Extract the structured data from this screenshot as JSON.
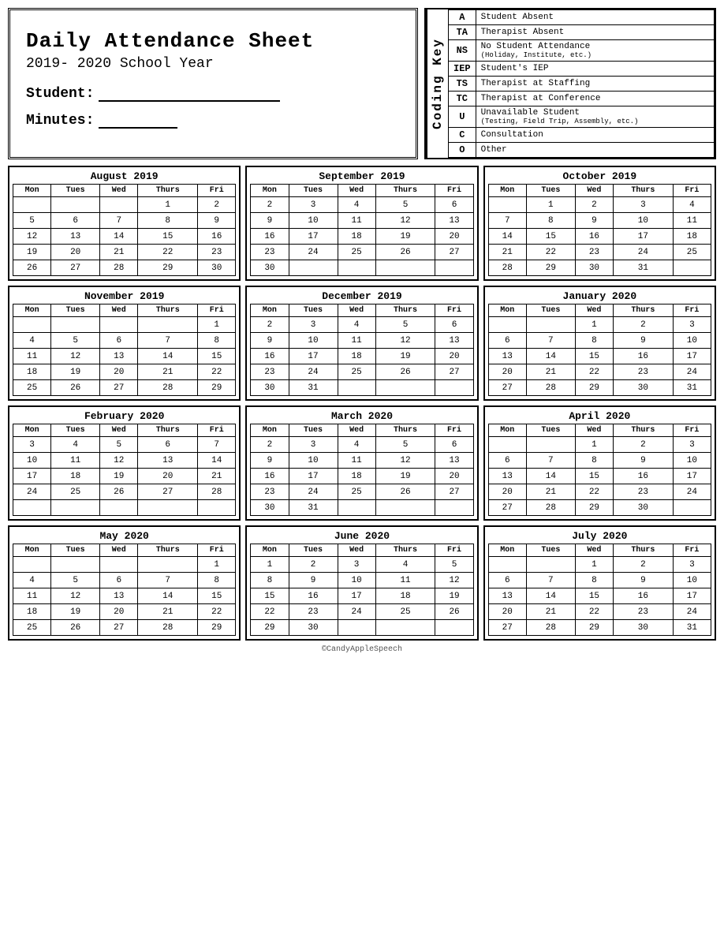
{
  "header": {
    "title": "Daily Attendance Sheet",
    "year": "2019- 2020 School Year",
    "student_label": "Student:",
    "minutes_label": "Minutes:",
    "coding_key_label": "Coding Key"
  },
  "coding_key": [
    {
      "code": "A",
      "description": "Student Absent",
      "sub": ""
    },
    {
      "code": "TA",
      "description": "Therapist Absent",
      "sub": ""
    },
    {
      "code": "NS",
      "description": "No Student Attendance",
      "sub": "(Holiday, Institute, etc.)"
    },
    {
      "code": "IEP",
      "description": "Student's IEP",
      "sub": ""
    },
    {
      "code": "TS",
      "description": "Therapist at Staffing",
      "sub": ""
    },
    {
      "code": "TC",
      "description": "Therapist at Conference",
      "sub": ""
    },
    {
      "code": "U",
      "description": "Unavailable Student",
      "sub": "(Testing, Field Trip, Assembly, etc.)"
    },
    {
      "code": "C",
      "description": "Consultation",
      "sub": ""
    },
    {
      "code": "O",
      "description": "Other",
      "sub": ""
    }
  ],
  "calendars": [
    {
      "title": "August 2019",
      "days": [
        [
          "",
          "",
          "",
          "1",
          "2"
        ],
        [
          "5",
          "6",
          "7",
          "8",
          "9"
        ],
        [
          "12",
          "13",
          "14",
          "15",
          "16"
        ],
        [
          "19",
          "20",
          "21",
          "22",
          "23"
        ],
        [
          "26",
          "27",
          "28",
          "29",
          "30"
        ]
      ]
    },
    {
      "title": "September 2019",
      "days": [
        [
          "2",
          "3",
          "4",
          "5",
          "6"
        ],
        [
          "9",
          "10",
          "11",
          "12",
          "13"
        ],
        [
          "16",
          "17",
          "18",
          "19",
          "20"
        ],
        [
          "23",
          "24",
          "25",
          "26",
          "27"
        ],
        [
          "30",
          "",
          "",
          "",
          ""
        ]
      ]
    },
    {
      "title": "October 2019",
      "days": [
        [
          "",
          "1",
          "2",
          "3",
          "4"
        ],
        [
          "7",
          "8",
          "9",
          "10",
          "11"
        ],
        [
          "14",
          "15",
          "16",
          "17",
          "18"
        ],
        [
          "21",
          "22",
          "23",
          "24",
          "25"
        ],
        [
          "28",
          "29",
          "30",
          "31",
          ""
        ]
      ]
    },
    {
      "title": "November 2019",
      "days": [
        [
          "",
          "",
          "",
          "",
          "1"
        ],
        [
          "4",
          "5",
          "6",
          "7",
          "8"
        ],
        [
          "11",
          "12",
          "13",
          "14",
          "15"
        ],
        [
          "18",
          "19",
          "20",
          "21",
          "22"
        ],
        [
          "25",
          "26",
          "27",
          "28",
          "29"
        ]
      ]
    },
    {
      "title": "December 2019",
      "days": [
        [
          "2",
          "3",
          "4",
          "5",
          "6"
        ],
        [
          "9",
          "10",
          "11",
          "12",
          "13"
        ],
        [
          "16",
          "17",
          "18",
          "19",
          "20"
        ],
        [
          "23",
          "24",
          "25",
          "26",
          "27"
        ],
        [
          "30",
          "31",
          "",
          "",
          ""
        ]
      ]
    },
    {
      "title": "January 2020",
      "days": [
        [
          "",
          "1",
          "2",
          "3"
        ],
        [
          "6",
          "7",
          "8",
          "9",
          "10"
        ],
        [
          "13",
          "14",
          "15",
          "16",
          "17"
        ],
        [
          "20",
          "21",
          "22",
          "23",
          "24"
        ],
        [
          "27",
          "28",
          "29",
          "30",
          "31"
        ]
      ]
    },
    {
      "title": "February 2020",
      "days": [
        [
          "3",
          "4",
          "5",
          "6",
          "7"
        ],
        [
          "10",
          "11",
          "12",
          "13",
          "14"
        ],
        [
          "17",
          "18",
          "19",
          "20",
          "21"
        ],
        [
          "24",
          "25",
          "26",
          "27",
          "28"
        ],
        [
          "",
          "",
          "",
          "",
          ""
        ]
      ]
    },
    {
      "title": "March 2020",
      "days": [
        [
          "2",
          "3",
          "4",
          "5",
          "6"
        ],
        [
          "9",
          "10",
          "11",
          "12",
          "13"
        ],
        [
          "16",
          "17",
          "18",
          "19",
          "20"
        ],
        [
          "23",
          "24",
          "25",
          "26",
          "27"
        ],
        [
          "30",
          "31",
          "",
          "",
          ""
        ]
      ]
    },
    {
      "title": "April 2020",
      "days": [
        [
          "",
          "1",
          "2",
          "3"
        ],
        [
          "6",
          "7",
          "8",
          "9",
          "10"
        ],
        [
          "13",
          "14",
          "15",
          "16",
          "17"
        ],
        [
          "20",
          "21",
          "22",
          "23",
          "24"
        ],
        [
          "27",
          "28",
          "29",
          "30",
          ""
        ]
      ]
    },
    {
      "title": "May 2020",
      "days": [
        [
          "",
          "",
          "",
          "",
          "1"
        ],
        [
          "4",
          "5",
          "6",
          "7",
          "8"
        ],
        [
          "11",
          "12",
          "13",
          "14",
          "15"
        ],
        [
          "18",
          "19",
          "20",
          "21",
          "22"
        ],
        [
          "25",
          "26",
          "27",
          "28",
          "29"
        ]
      ]
    },
    {
      "title": "June 2020",
      "days": [
        [
          "1",
          "2",
          "3",
          "4",
          "5"
        ],
        [
          "8",
          "9",
          "10",
          "11",
          "12"
        ],
        [
          "15",
          "16",
          "17",
          "18",
          "19"
        ],
        [
          "22",
          "23",
          "24",
          "25",
          "26"
        ],
        [
          "29",
          "30",
          "",
          "",
          ""
        ]
      ]
    },
    {
      "title": "July 2020",
      "days": [
        [
          "",
          "1",
          "2",
          "3"
        ],
        [
          "6",
          "7",
          "8",
          "9",
          "10"
        ],
        [
          "13",
          "14",
          "15",
          "16",
          "17"
        ],
        [
          "20",
          "21",
          "22",
          "23",
          "24"
        ],
        [
          "27",
          "28",
          "29",
          "30",
          "31"
        ]
      ]
    }
  ],
  "col_headers": [
    "Mon",
    "Tues",
    "Wed",
    "Thurs",
    "Fri"
  ],
  "footer": "©CandyAppleSpeech"
}
